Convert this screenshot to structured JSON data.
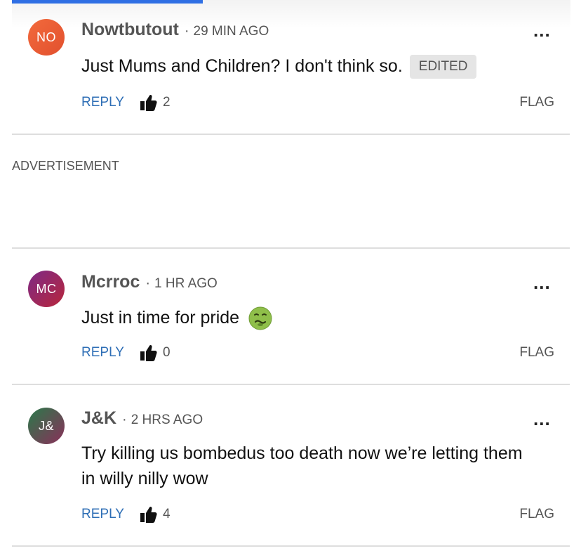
{
  "comments": [
    {
      "initials": "NO",
      "username": "Nowtbutout",
      "separator": "·",
      "time": "29 MIN AGO",
      "text": "Just Mums and Children? I don't think so.",
      "badge": "EDITED",
      "more": "...",
      "reply_label": "REPLY",
      "likes": "2",
      "flag_label": "FLAG",
      "avatar_color": "#ee5f36"
    },
    {
      "initials": "MC",
      "username": "Mcrroc",
      "separator": "·",
      "time": "1 HR AGO",
      "text": "Just in time for pride",
      "emoji": "nauseated-face-emoji",
      "more": "...",
      "reply_label": "REPLY",
      "likes": "0",
      "flag_label": "FLAG",
      "avatar_color": "#9a2a62"
    },
    {
      "initials": "J&",
      "username": "J&K",
      "separator": "·",
      "time": "2 HRS AGO",
      "text": "Try killing us bombedus too death now we’re letting them in willy nilly wow",
      "more": "...",
      "reply_label": "REPLY",
      "likes": "4",
      "flag_label": "FLAG",
      "avatar_color": "#4f5c4f"
    }
  ],
  "advertisement": {
    "label": "ADVERTISEMENT"
  },
  "colors": {
    "accent_blue": "#2f6fe4",
    "reply_link": "#2f6fb6",
    "divider": "#dedede"
  }
}
